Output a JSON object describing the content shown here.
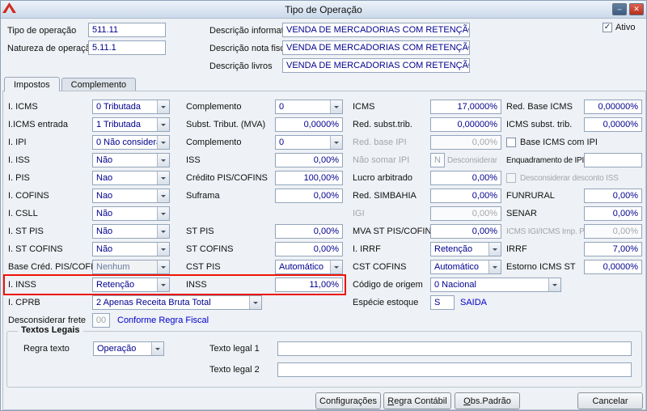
{
  "colors": {
    "value_text": "#00008f",
    "link_text": "#0000cc",
    "highlight_box": "#ee1408",
    "close_button": "#b5301f",
    "dialog_background": "#eef1f5"
  },
  "window": {
    "title": "Tipo de Operação",
    "minimize_glyph": "–",
    "close_glyph": "✕"
  },
  "header": {
    "tipo_operacao": {
      "label": "Tipo de operação",
      "value": "511.11"
    },
    "natureza_operacao": {
      "label": "Natureza de operação",
      "value": "5.11.1"
    },
    "descricao_informativa": {
      "label": "Descrição informativa",
      "value": "VENDA DE MERCADORIAS COM RETENÇÃO"
    },
    "descricao_nota_fiscal": {
      "label": "Descrição nota fiscal",
      "value": "VENDA DE MERCADORIAS COM RETENÇÃO"
    },
    "descricao_livros": {
      "label": "Descrição livros",
      "value": "VENDA DE MERCADORIAS COM RETENÇÃO"
    },
    "ativo": {
      "label": "Ativo",
      "checked": true,
      "check_glyph": "✓"
    }
  },
  "tabs": {
    "impostos": "Impostos",
    "complemento": "Complemento"
  },
  "form": {
    "i_icms": {
      "label": "I. ICMS",
      "value": "0 Tributada"
    },
    "complemento_icms": {
      "label": "Complemento",
      "value": "0"
    },
    "icms": {
      "label": "ICMS",
      "value": "17,0000%"
    },
    "red_base_icms": {
      "label": "Red. Base ICMS",
      "value": "0,00000%"
    },
    "i_icms_entrada": {
      "label": "I.ICMS entrada",
      "value": "1 Tributada"
    },
    "subst_tribut_mva": {
      "label": "Subst. Tribut. (MVA)",
      "value": "0,0000%"
    },
    "red_subst_trib": {
      "label": "Red. subst.trib.",
      "value": "0,00000%"
    },
    "icms_subst_trib": {
      "label": "ICMS subst. trib.",
      "value": "0,0000%"
    },
    "i_ipi": {
      "label": "I. IPI",
      "value": "0 Não considera"
    },
    "complemento_ipi": {
      "label": "Complemento",
      "value": "0"
    },
    "red_base_ipi": {
      "label": "Red. base IPI",
      "value": "0,00%"
    },
    "base_icms_com_ipi": {
      "label": "Base ICMS com IPI",
      "checked": false
    },
    "i_iss": {
      "label": "I. ISS",
      "value": "Não"
    },
    "iss": {
      "label": "ISS",
      "value": "0,00%"
    },
    "nao_somar_ipi": {
      "label": "Não somar IPI",
      "value": "N",
      "suffix": "Desconsiderar"
    },
    "enquadramento_ipi": {
      "label": "Enquadramento de IPI",
      "value": ""
    },
    "i_pis": {
      "label": "I. PIS",
      "value": "Nao"
    },
    "credito_pis_cofins": {
      "label": "Crédito PIS/COFINS",
      "value": "100,00%"
    },
    "lucro_arbitrado": {
      "label": "Lucro arbitrado",
      "value": "0,00%"
    },
    "desconsiderar_desconto_iss": {
      "label": "Desconsiderar desconto ISS",
      "checked": false
    },
    "i_cofins": {
      "label": "I. COFINS",
      "value": "Nao"
    },
    "suframa": {
      "label": "Suframa",
      "value": "0,00%"
    },
    "red_simbahia": {
      "label": "Red. SIMBAHIA",
      "value": "0,00%"
    },
    "funrural": {
      "label": "FUNRURAL",
      "value": "0,00%"
    },
    "i_csll": {
      "label": "I. CSLL",
      "value": "Não"
    },
    "igi": {
      "label": "IGI",
      "value": "0,00%"
    },
    "senar": {
      "label": "SENAR",
      "value": "0,00%"
    },
    "i_st_pis": {
      "label": "I. ST PIS",
      "value": "Não"
    },
    "st_pis": {
      "label": "ST PIS",
      "value": "0,00%"
    },
    "mva_st_pis_cofins": {
      "label": "MVA ST PIS/COFINS",
      "value": "0,00%"
    },
    "icms_igi": {
      "label": "ICMS IGI/ICMS Imp. PR",
      "value": "0,00%"
    },
    "i_st_cofins": {
      "label": "I. ST COFINS",
      "value": "Não"
    },
    "st_cofins": {
      "label": "ST COFINS",
      "value": "0,00%"
    },
    "i_irrf": {
      "label": "I. IRRF",
      "value": "Retenção"
    },
    "irrf": {
      "label": "IRRF",
      "value": "7,00%"
    },
    "base_cred_pis_cofins": {
      "label": "Base Créd. PIS/COFINS",
      "value": "Nenhum"
    },
    "cst_pis": {
      "label": "CST PIS",
      "value": "Automático"
    },
    "cst_cofins": {
      "label": "CST COFINS",
      "value": "Automático"
    },
    "estorno_icms_st": {
      "label": "Estorno ICMS ST",
      "value": "0,0000%"
    },
    "i_inss": {
      "label": "I. INSS",
      "value": "Retenção"
    },
    "inss": {
      "label": "INSS",
      "value": "11,00%"
    },
    "codigo_origem": {
      "label": "Código de origem",
      "value": "0 Nacional"
    },
    "i_cprb": {
      "label": "I. CPRB",
      "value": "2 Apenas Receita Bruta Total"
    },
    "especie_estoque": {
      "label": "Espécie estoque",
      "value": "S",
      "suffix": "SAIDA"
    },
    "desconsiderar_frete": {
      "label": "Desconsiderar frete",
      "value": "00",
      "suffix": "Conforme Regra Fiscal"
    }
  },
  "textos_legais": {
    "title": "Textos Legais",
    "regra_texto": {
      "label": "Regra texto",
      "value": "Operação"
    },
    "texto_legal_1": {
      "label": "Texto legal 1",
      "value": ""
    },
    "texto_legal_2": {
      "label": "Texto legal 2",
      "value": ""
    }
  },
  "footer": {
    "configuracoes": "Configurações",
    "regra_contabil": "Regra Contábil",
    "obs_padrao": "Obs.Padrão",
    "cancelar": "Cancelar"
  }
}
